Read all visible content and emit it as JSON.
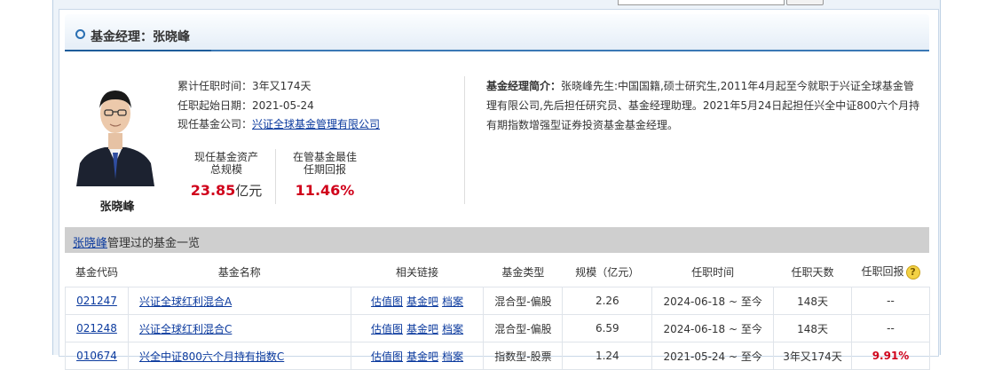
{
  "header": {
    "title": "基金经理：张晓峰"
  },
  "manager": {
    "name": "张晓峰",
    "tenure": "累计任职时间：3年又174天",
    "start_date": "任职起始日期：2021-05-24",
    "company_label": "现任基金公司：",
    "company": "兴证全球基金管理有限公司"
  },
  "stats": {
    "assets_label_1": "现任基金资产",
    "assets_label_2": "总规模",
    "assets_value": "23.85",
    "assets_unit": "亿元",
    "best_label_1": "在管基金最佳",
    "best_label_2": "任期回报",
    "best_value": "11.46%"
  },
  "intro": {
    "label": "基金经理简介：",
    "text": "张晓峰先生:中国国籍,硕士研究生,2011年4月起至今就职于兴证全球基金管理有限公司,先后担任研究员、基金经理助理。2021年5月24日起担任兴全中证800六个月持有期指数增强型证券投资基金基金经理。"
  },
  "list": {
    "manager_link": "张晓峰",
    "title_suffix": "管理过的基金一览",
    "columns": [
      "基金代码",
      "基金名称",
      "相关链接",
      "基金类型",
      "规模（亿元）",
      "任职时间",
      "任职天数",
      "任职回报"
    ],
    "link_labels": [
      "估值图",
      "基金吧",
      "档案"
    ],
    "rows": [
      {
        "code": "021247",
        "name": "兴证全球红利混合A",
        "type": "混合型-偏股",
        "size": "2.26",
        "period": "2024-06-18 ~ 至今",
        "days": "148天",
        "return": "--"
      },
      {
        "code": "021248",
        "name": "兴证全球红利混合C",
        "type": "混合型-偏股",
        "size": "6.59",
        "period": "2024-06-18 ~ 至今",
        "days": "148天",
        "return": "--"
      },
      {
        "code": "010674",
        "name": "兴全中证800六个月持有指数C",
        "type": "指数型-股票",
        "size": "1.24",
        "period": "2021-05-24 ~ 至今",
        "days": "3年又174天",
        "return": "9.91%"
      }
    ]
  },
  "colors": {
    "accent": "#2a6fb2",
    "return_red": "#d0021b",
    "link": "#0b3a9e"
  }
}
